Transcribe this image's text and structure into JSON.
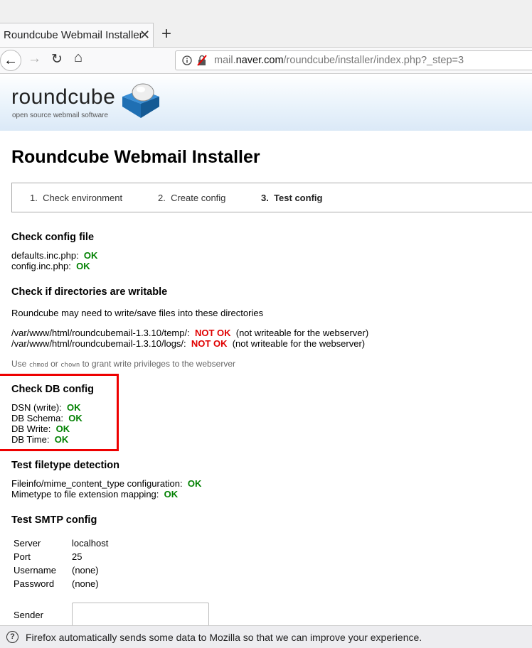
{
  "browser": {
    "tab_title": "Roundcube Webmail Installer",
    "tab_close": "✕",
    "new_tab": "+",
    "back": "←",
    "forward": "→",
    "reload": "↻",
    "home": "⌂",
    "url_scheme": "mail.",
    "url_host": "naver.com",
    "url_path": "/roundcube/installer/index.php?_step=3"
  },
  "logo": {
    "name": "roundcube",
    "tagline": "open source webmail software"
  },
  "page_title": "Roundcube Webmail Installer",
  "steps": [
    {
      "num": "1.",
      "label": "Check environment"
    },
    {
      "num": "2.",
      "label": "Create config"
    },
    {
      "num": "3.",
      "label": "Test config"
    }
  ],
  "config_file": {
    "heading": "Check config file",
    "items": [
      {
        "label": "defaults.inc.php:",
        "status": "OK"
      },
      {
        "label": "config.inc.php:",
        "status": "OK"
      }
    ]
  },
  "dirs": {
    "heading": "Check if directories are writable",
    "intro": "Roundcube may need to write/save files into these directories",
    "items": [
      {
        "path": "/var/www/html/roundcubemail-1.3.10/temp/:",
        "status": "NOT OK",
        "note": "(not writeable for the webserver)"
      },
      {
        "path": "/var/www/html/roundcubemail-1.3.10/logs/:",
        "status": "NOT OK",
        "note": "(not writeable for the webserver)"
      }
    ],
    "hint_pre": "Use",
    "hint_cmd1": "chmod",
    "hint_or": "or",
    "hint_cmd2": "chown",
    "hint_post": "to grant write privileges to the webserver"
  },
  "db": {
    "heading": "Check DB config",
    "items": [
      {
        "label": "DSN (write):",
        "status": "OK"
      },
      {
        "label": "DB Schema:",
        "status": "OK"
      },
      {
        "label": "DB Write:",
        "status": "OK"
      },
      {
        "label": "DB Time:",
        "status": "OK"
      }
    ]
  },
  "filetype": {
    "heading": "Test filetype detection",
    "items": [
      {
        "label": "Fileinfo/mime_content_type configuration:",
        "status": "OK"
      },
      {
        "label": "Mimetype to file extension mapping:",
        "status": "OK"
      }
    ]
  },
  "smtp": {
    "heading": "Test SMTP config",
    "rows": [
      {
        "label": "Server",
        "value": "localhost"
      },
      {
        "label": "Port",
        "value": "25"
      },
      {
        "label": "Username",
        "value": "(none)"
      },
      {
        "label": "Password",
        "value": "(none)"
      }
    ],
    "sender_label": "Sender",
    "sender_value": ""
  },
  "notice": {
    "icon": "?",
    "text": "Firefox automatically sends some data to Mozilla so that we can improve your experience."
  },
  "colors": {
    "ok": "#008000",
    "not_ok": "#e00000",
    "highlight": "#e00000"
  }
}
